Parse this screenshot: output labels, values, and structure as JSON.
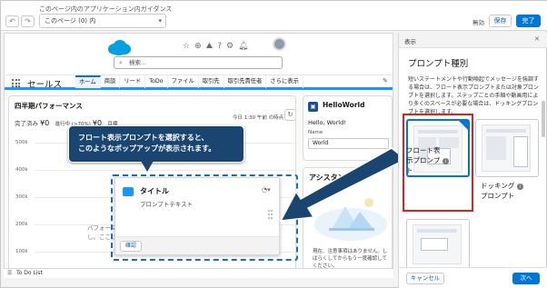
{
  "builder": {
    "caption": "このページ内のアプリケーション内ガイダンス",
    "undo": "↶",
    "redo": "↷",
    "page_select": "このページ (0) 内",
    "status": "無効",
    "save": "保存",
    "done": "完了"
  },
  "app": {
    "search_placeholder": "検索...",
    "app_name": "セールス",
    "tabs": [
      "ホーム",
      "商談",
      "リード",
      "ToDo",
      "ファイル",
      "取引先",
      "取引先責任者",
      "さらに表示"
    ],
    "perf": {
      "title": "四半期パフォーマンス",
      "date": "今日 1:30 午前 の時点",
      "closed_label": "完了済み",
      "closed_value": "¥0",
      "open_label": "進行中 (>70%)",
      "open_value": "¥0",
      "goal_label": "目標",
      "y_ticks": [
        "500k",
        "400k",
        "300k",
        "200k",
        "100k"
      ],
      "ghost_line1": "パフォーマ",
      "ghost_line2": "し。ここに"
    },
    "helloworld": {
      "title": "HelloWorld",
      "greeting": "Hello, World!",
      "name_label": "Name",
      "name_value": "World"
    },
    "assistant": {
      "title": "アシスタント",
      "text": "現在、注意事項はありません。しばらくしてからもう一度確認してください。"
    },
    "todo": "To Do List"
  },
  "prompt": {
    "title": "タイトル",
    "body": "プロンプトテキスト",
    "confirm": "確認"
  },
  "callout": {
    "line1": "フロート表示プロンプトを選択すると、",
    "line2": "このようなポップアップが表示されます。"
  },
  "panel": {
    "header": "表示",
    "title": "プロンプト種別",
    "desc": "短いステートメントや行動喚起でメッセージを強調する場合は、フロート表示プロンプトまたは対象プロンプトを選択します。ステップごとの手順や動画用により多くのスペースが必要な場合は、ドッキングプロンプトを選択します。",
    "option_float_l1": "フロート表",
    "option_float_l2": "示プロンプ",
    "option_float_l3": "ト",
    "option_dock_l1": "ドッキング",
    "option_dock_l2": "プロンプト",
    "cancel": "キャンセル",
    "next": "次へ"
  },
  "colors": {
    "accent": "#0176d3",
    "callout": "#1a4570",
    "highlight": "#e02020"
  }
}
